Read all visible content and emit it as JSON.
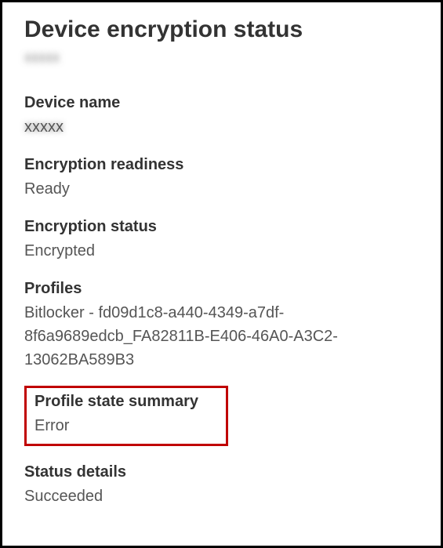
{
  "title": "Device encryption status",
  "subtitle_blurred": "xxxxx",
  "sections": {
    "device_name": {
      "label": "Device name",
      "value_blurred": "xxxxx"
    },
    "encryption_readiness": {
      "label": "Encryption readiness",
      "value": "Ready"
    },
    "encryption_status": {
      "label": "Encryption status",
      "value": "Encrypted"
    },
    "profiles": {
      "label": "Profiles",
      "value": "Bitlocker - fd09d1c8-a440-4349-a7df-8f6a9689edcb_FA82811B-E406-46A0-A3C2-13062BA589B3"
    },
    "profile_state_summary": {
      "label": "Profile state summary",
      "value": "Error"
    },
    "status_details": {
      "label": "Status details",
      "value": "Succeeded"
    }
  }
}
